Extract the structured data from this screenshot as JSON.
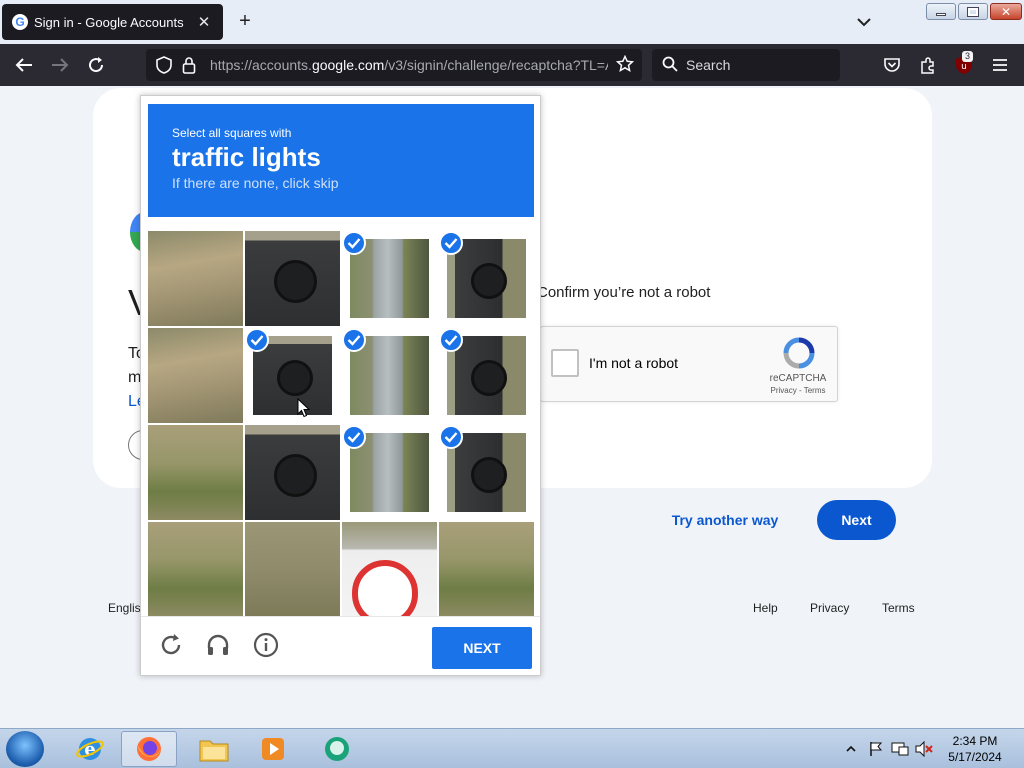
{
  "browser": {
    "tab_title": "Sign in - Google Accounts",
    "url_prefix": "https://accounts.",
    "url_domain": "google.com",
    "url_rest": "/v3/signin/challenge/recaptcha?TL=A",
    "search_placeholder": "Search",
    "extension_badge": "3"
  },
  "signin": {
    "heading_partial": "V",
    "line1_partial": "To",
    "line2_partial": "m",
    "line3_partial": "Le",
    "confirm_text": "Confirm you’re not a robot",
    "checkbox_label": "I'm not a robot",
    "recaptcha_brand": "reCAPTCHA",
    "recaptcha_links": "Privacy - Terms",
    "try_another": "Try another way",
    "next": "Next",
    "footer_lang": "Englis",
    "footer_help": "Help",
    "footer_privacy": "Privacy",
    "footer_terms": "Terms"
  },
  "challenge": {
    "instruction": "Select all squares with",
    "target": "traffic lights",
    "hint": "If there are none, click skip",
    "next": "NEXT",
    "tiles": [
      {
        "row": 0,
        "col": 0,
        "selected": false,
        "scene": "hill"
      },
      {
        "row": 0,
        "col": 1,
        "selected": false,
        "scene": "light"
      },
      {
        "row": 0,
        "col": 2,
        "selected": true,
        "scene": "pole"
      },
      {
        "row": 0,
        "col": 3,
        "selected": true,
        "scene": "light-edge"
      },
      {
        "row": 1,
        "col": 0,
        "selected": false,
        "scene": "hill"
      },
      {
        "row": 1,
        "col": 1,
        "selected": true,
        "scene": "light"
      },
      {
        "row": 1,
        "col": 2,
        "selected": true,
        "scene": "pole"
      },
      {
        "row": 1,
        "col": 3,
        "selected": true,
        "scene": "light-edge"
      },
      {
        "row": 2,
        "col": 0,
        "selected": false,
        "scene": "brush"
      },
      {
        "row": 2,
        "col": 1,
        "selected": false,
        "scene": "light"
      },
      {
        "row": 2,
        "col": 2,
        "selected": true,
        "scene": "pole"
      },
      {
        "row": 2,
        "col": 3,
        "selected": true,
        "scene": "light-edge"
      },
      {
        "row": 3,
        "col": 0,
        "selected": false,
        "scene": "brush"
      },
      {
        "row": 3,
        "col": 1,
        "selected": false,
        "scene": "ground"
      },
      {
        "row": 3,
        "col": 2,
        "selected": false,
        "scene": "sign"
      },
      {
        "row": 3,
        "col": 3,
        "selected": false,
        "scene": "brush"
      }
    ]
  },
  "taskbar": {
    "time": "2:34 PM",
    "date": "5/17/2024",
    "apps": [
      "internet-explorer",
      "firefox",
      "file-explorer",
      "media-player",
      "app"
    ]
  }
}
